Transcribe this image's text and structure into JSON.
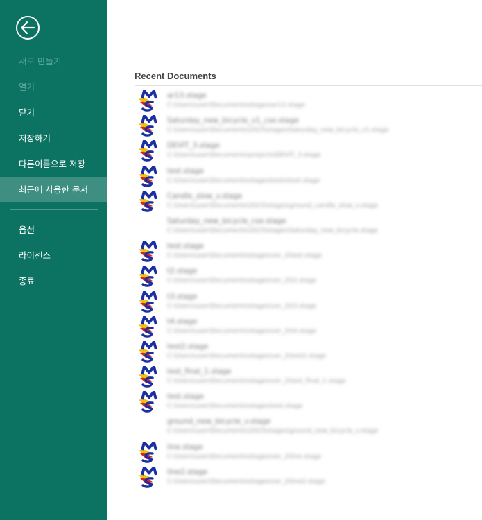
{
  "sidebar": {
    "back_icon": "back-arrow-circle-icon",
    "items": [
      {
        "label": "새로 만들기",
        "state": "disabled"
      },
      {
        "label": "열기",
        "state": "disabled"
      },
      {
        "label": "닫기",
        "state": "normal"
      },
      {
        "label": "저장하기",
        "state": "normal"
      },
      {
        "label": "다른이름으로 저장",
        "state": "normal"
      },
      {
        "label": "최근에 사용한 문서",
        "state": "active"
      }
    ],
    "items_bottom": [
      {
        "label": "옵션"
      },
      {
        "label": "라이센스"
      },
      {
        "label": "종료"
      }
    ],
    "colors": {
      "background": "#0c7262",
      "active": "#3e8e81",
      "disabled_text": "#5fa89b"
    }
  },
  "recent": {
    "title": "Recent Documents",
    "documents": [
      {
        "name": "ar13.stage",
        "path": "C:\\Users\\user\\Documents\\stages\\ar13.stage",
        "icon": true
      },
      {
        "name": "Saturday_new_bicycle_v1_cse.stage",
        "path": "C:\\Users\\user\\Documents\\2023\\stages\\Saturday_new_bicycle_v1.stage",
        "icon": true
      },
      {
        "name": "DEVIT_3.stage",
        "path": "C:\\Users\\user\\Documents\\projects\\DEVIT_3.stage",
        "icon": true
      },
      {
        "name": "test.stage",
        "path": "C:\\Users\\user\\Documents\\stages\\tests\\test.stage",
        "icon": true
      },
      {
        "name": "Candle_slow_v.stage",
        "path": "C:\\Users\\user\\Documents\\2023\\stages\\ground_candle_slow_v.stage",
        "icon": true
      },
      {
        "name": "Saturday_new_bicycle_cse.stage",
        "path": "C:\\Users\\user\\Documents\\2023\\stages\\Saturday_new_bicycle.stage",
        "icon": false
      },
      {
        "name": "test.stage",
        "path": "C:\\Users\\user\\Documents\\stages\\ver_2\\test.stage",
        "icon": true
      },
      {
        "name": "t2.stage",
        "path": "C:\\Users\\user\\Documents\\stages\\ver_2\\t2.stage",
        "icon": true
      },
      {
        "name": "t3.stage",
        "path": "C:\\Users\\user\\Documents\\stages\\ver_2\\t3.stage",
        "icon": true
      },
      {
        "name": "t4.stage",
        "path": "C:\\Users\\user\\Documents\\stages\\ver_2\\t4.stage",
        "icon": true
      },
      {
        "name": "test2.stage",
        "path": "C:\\Users\\user\\Documents\\stages\\ver_2\\test2.stage",
        "icon": true
      },
      {
        "name": "test_final_1.stage",
        "path": "C:\\Users\\user\\Documents\\stages\\ver_2\\test_final_1.stage",
        "icon": true
      },
      {
        "name": "test.stage",
        "path": "C:\\Users\\user\\Documents\\stages\\test.stage",
        "icon": true
      },
      {
        "name": "ground_new_bicycle_v.stage",
        "path": "C:\\Users\\user\\Documents\\2023\\stages\\ground_new_bicycle_v.stage",
        "icon": false
      },
      {
        "name": "line.stage",
        "path": "C:\\Users\\user\\Documents\\stages\\ver_2\\line.stage",
        "icon": true
      },
      {
        "name": "line2.stage",
        "path": "C:\\Users\\user\\Documents\\stages\\ver_2\\line2.stage",
        "icon": true
      }
    ]
  }
}
